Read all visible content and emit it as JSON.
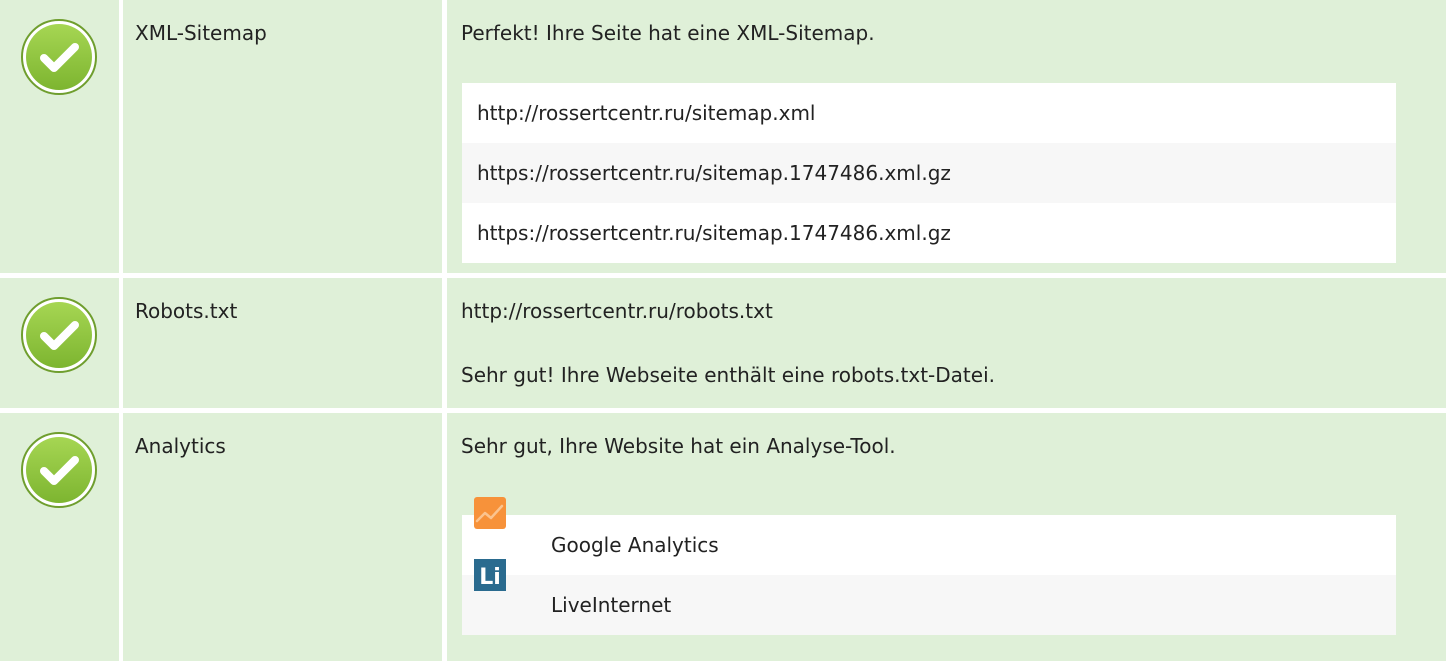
{
  "colors": {
    "row_background": "#dff0d8",
    "check_green": "#8cc63f",
    "check_border": "#6f9e2e",
    "list_odd": "#ffffff",
    "list_even": "#f7f7f7",
    "google_analytics_orange": "#f7923a",
    "liveinternet_blue": "#2a6b8f"
  },
  "rows": [
    {
      "status_icon": "check-circle-icon",
      "label": "XML-Sitemap",
      "message": "Perfekt! Ihre Seite hat eine XML-Sitemap.",
      "sitemaps": [
        "http://rossertcentr.ru/sitemap.xml",
        "https://rossertcentr.ru/sitemap.1747486.xml.gz",
        "https://rossertcentr.ru/sitemap.1747486.xml.gz"
      ]
    },
    {
      "status_icon": "check-circle-icon",
      "label": "Robots.txt",
      "url": "http://rossertcentr.ru/robots.txt",
      "message": "Sehr gut! Ihre Webseite enthält eine robots.txt-Datei."
    },
    {
      "status_icon": "check-circle-icon",
      "label": "Analytics",
      "message": "Sehr gut, Ihre Website hat ein Analyse-Tool.",
      "tools": [
        {
          "name": "Google Analytics",
          "icon": "google-analytics-icon"
        },
        {
          "name": "LiveInternet",
          "icon": "liveinternet-icon",
          "icon_text": "Li"
        }
      ]
    }
  ]
}
